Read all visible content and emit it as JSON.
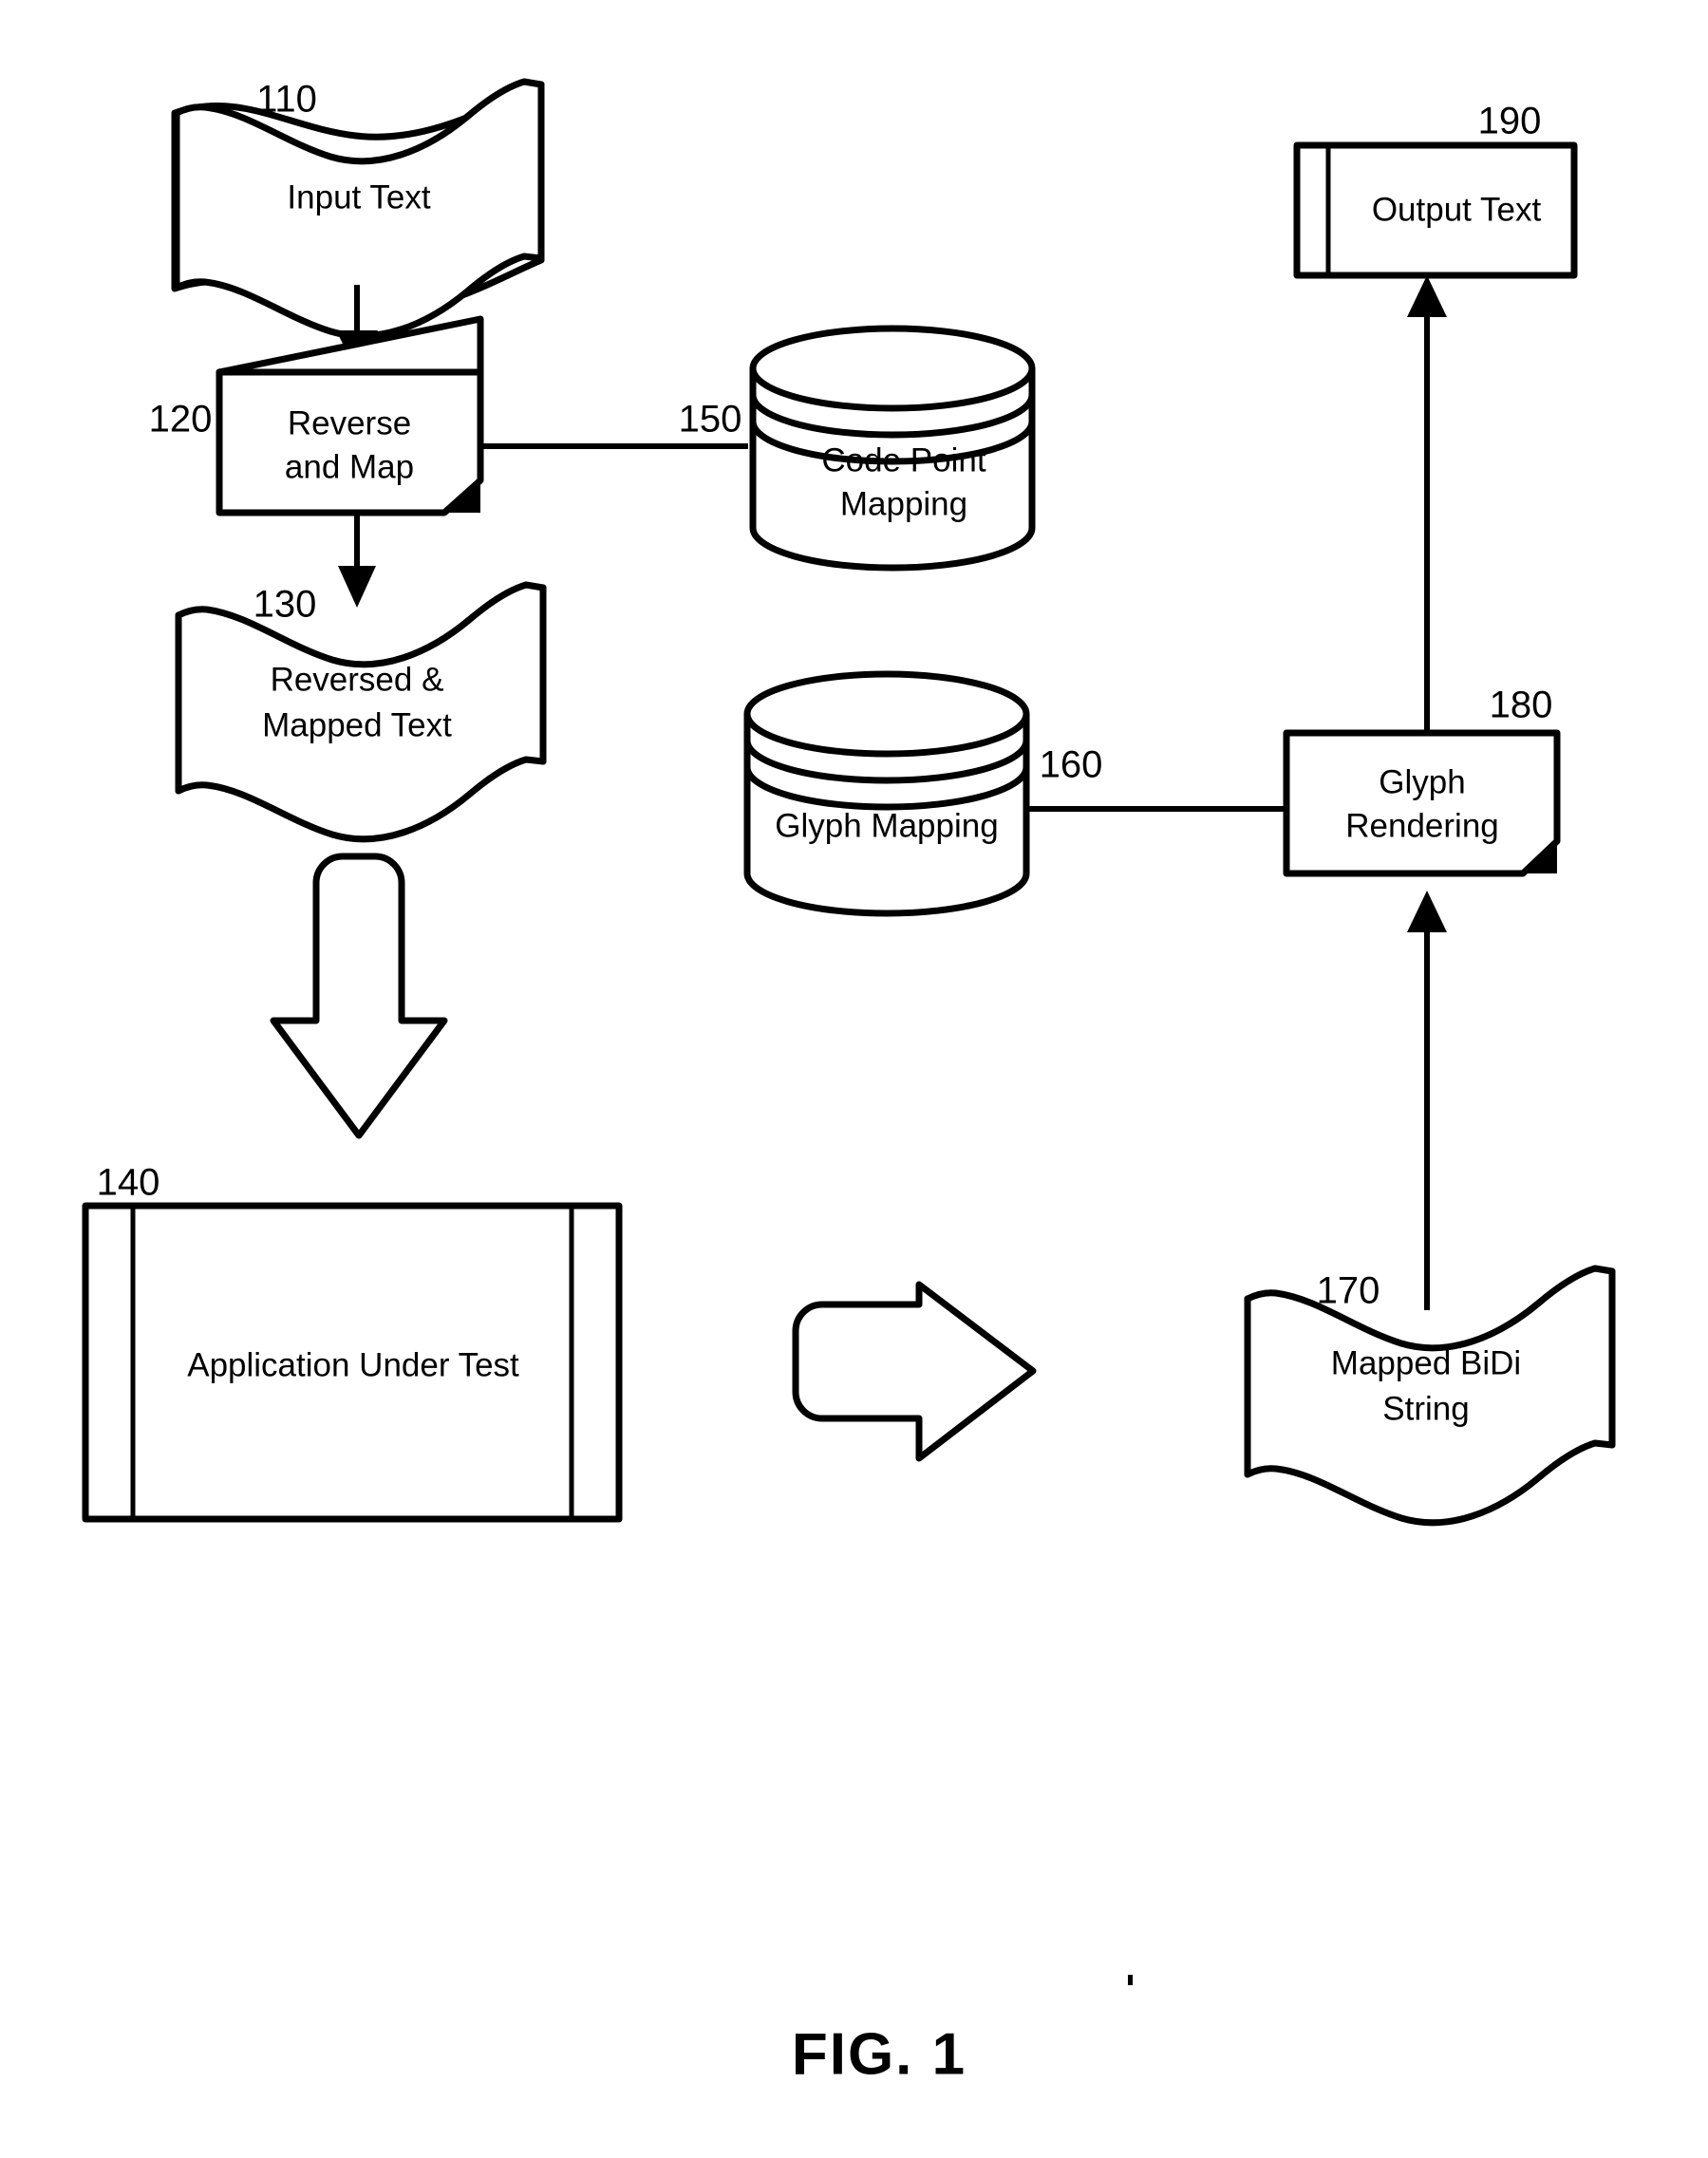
{
  "figure": {
    "caption": "FIG. 1",
    "title": "FIG. 1"
  },
  "nodes": {
    "input_text": {
      "ref": "110",
      "label": "Input Text",
      "shape": "wavy-document"
    },
    "reverse_and_map": {
      "ref": "120",
      "label_line1": "Reverse",
      "label_line2": "and Map",
      "shape": "process-box-folded-corner"
    },
    "reversed_mapped_text": {
      "ref": "130",
      "label_line1": "Reversed &",
      "label_line2": "Mapped Text",
      "shape": "wavy-document"
    },
    "application_under_test": {
      "ref": "140",
      "label": "Application Under Test",
      "shape": "window-box"
    },
    "code_point_mapping": {
      "ref": "150",
      "label_line1": "Code Point",
      "label_line2": "Mapping",
      "shape": "stacked-cylinder-database"
    },
    "glyph_mapping": {
      "ref": "160",
      "label": "Glyph Mapping",
      "shape": "stacked-cylinder-database"
    },
    "mapped_bidi_string": {
      "ref": "170",
      "label_line1": "Mapped BiDi",
      "label_line2": "String",
      "shape": "wavy-document"
    },
    "glyph_rendering": {
      "ref": "180",
      "label_line1": "Glyph",
      "label_line2": "Rendering",
      "shape": "process-box-folded-corner"
    },
    "output_text": {
      "ref": "190",
      "label": "Output Text",
      "shape": "display-box"
    }
  },
  "connectors": [
    {
      "name": "input-text-to-reverse-and-map",
      "from": "110",
      "to": "120",
      "kind": "arrow-down"
    },
    {
      "name": "reverse-and-map-to-reversed-mapped-text",
      "from": "120",
      "to": "130",
      "kind": "arrow-down"
    },
    {
      "name": "reverse-and-map-to-code-point-mapping",
      "from": "120",
      "to": "150",
      "kind": "plain-line"
    },
    {
      "name": "reversed-mapped-text-to-application-under-test",
      "from": "130",
      "to": "140",
      "kind": "block-arrow-down"
    },
    {
      "name": "application-under-test-to-mapped-bidi-string",
      "from": "140",
      "to": "170",
      "kind": "block-arrow-right"
    },
    {
      "name": "mapped-bidi-string-to-glyph-rendering",
      "from": "170",
      "to": "180",
      "kind": "arrow-up"
    },
    {
      "name": "glyph-mapping-to-glyph-rendering",
      "from": "160",
      "to": "180",
      "kind": "plain-line"
    },
    {
      "name": "glyph-rendering-to-output-text",
      "from": "180",
      "to": "190",
      "kind": "arrow-up"
    }
  ],
  "colors": {
    "ink": "#000000",
    "paper": "#ffffff"
  }
}
